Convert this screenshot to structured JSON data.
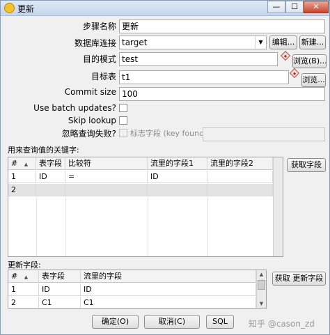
{
  "window": {
    "title": "更新",
    "title_icon": "refresh-icon",
    "controls": {
      "minimize": "—",
      "maximize": "☐",
      "close": "✕"
    }
  },
  "form": {
    "step_name_label": "步骤名称",
    "step_name_value": "更新",
    "db_conn_label": "数据库连接",
    "db_conn_value": "target",
    "edit_button": "编辑...",
    "new_button": "新建...",
    "target_schema_label": "目的模式",
    "target_schema_value": "test",
    "browse_schema_button": "浏览(B)...",
    "target_table_label": "目标表",
    "target_table_value": "t1",
    "browse_table_button": "浏览...",
    "commit_size_label": "Commit size",
    "commit_size_value": "100",
    "batch_updates_label": "Use batch updates?",
    "skip_lookup_label": "Skip lookup",
    "ignore_lookup_fail_label": "忽略查询失败?",
    "flag_field_label": "标志字段 (key found)",
    "flag_field_value": ""
  },
  "keys_section": {
    "label": "用来查询值的关键字:",
    "get_fields_button": "获取字段",
    "columns": [
      "#",
      "表字段",
      "比较符",
      "流里的字段1",
      "流里的字段2"
    ],
    "rows": [
      [
        "1",
        "ID",
        "=",
        "ID",
        ""
      ],
      [
        "2",
        "",
        "",
        "",
        ""
      ]
    ]
  },
  "update_section": {
    "label": "更新字段:",
    "get_update_fields_button": "获取 更新字段",
    "columns": [
      "#",
      "表字段",
      "流里的字段"
    ],
    "rows": [
      [
        "1",
        "ID",
        "ID"
      ],
      [
        "2",
        "C1",
        "C1"
      ]
    ]
  },
  "footer": {
    "ok_button": "确定(O)",
    "cancel_button": "取消(C)",
    "sql_button": "SQL",
    "watermark": "知乎 @cason_zd"
  }
}
